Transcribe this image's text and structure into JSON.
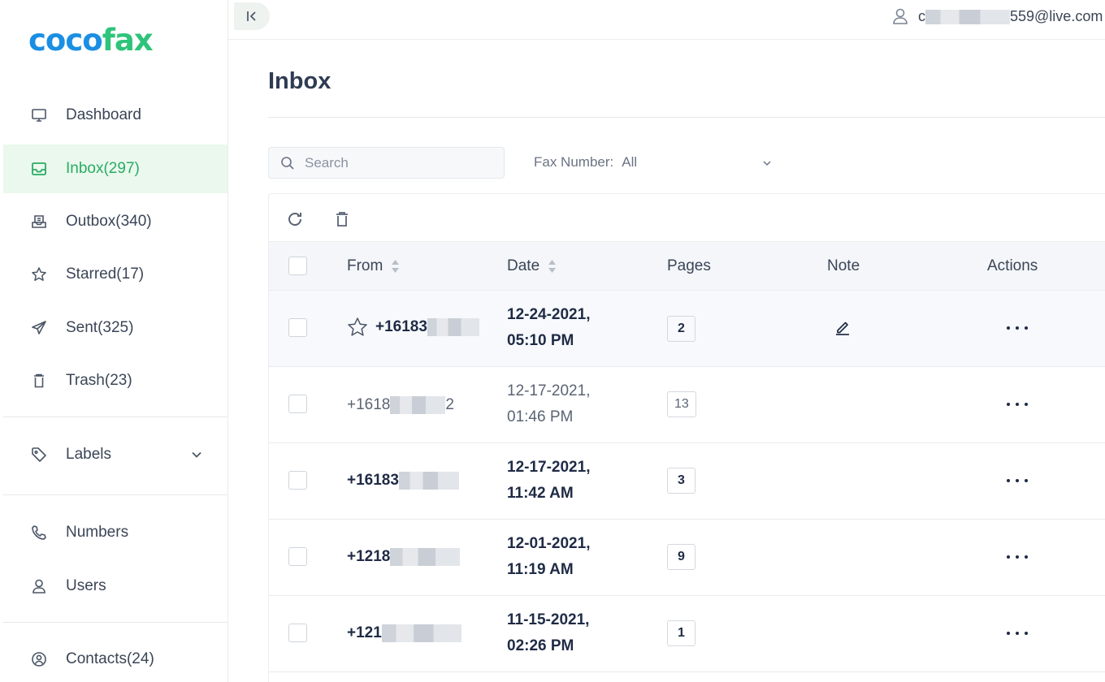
{
  "app": {
    "logo_part1": "coco",
    "logo_part2": "fax",
    "brand_blue": "#1a8fe3",
    "brand_green": "#2ec47a"
  },
  "sidebar": {
    "items": [
      {
        "label": "Dashboard",
        "icon": "monitor-icon"
      },
      {
        "label": "Inbox(297)",
        "icon": "inbox-icon",
        "active": true
      },
      {
        "label": "Outbox(340)",
        "icon": "outbox-icon"
      },
      {
        "label": "Starred(17)",
        "icon": "star-icon"
      },
      {
        "label": "Sent(325)",
        "icon": "paper-plane-icon"
      },
      {
        "label": "Trash(23)",
        "icon": "trash-icon"
      },
      {
        "label": "Labels",
        "icon": "tag-icon"
      },
      {
        "label": "Numbers",
        "icon": "phone-icon"
      },
      {
        "label": "Users",
        "icon": "user-icon"
      },
      {
        "label": "Contacts(24)",
        "icon": "contact-circle-icon"
      }
    ]
  },
  "topbar": {
    "email_prefix": "c",
    "email_suffix": "559@live.com"
  },
  "main": {
    "title": "Inbox",
    "search_placeholder": "Search",
    "fax_number_label": "Fax Number:",
    "fax_number_value": "All"
  },
  "table": {
    "columns": {
      "from": "From",
      "date": "Date",
      "pages": "Pages",
      "note": "Note",
      "actions": "Actions"
    },
    "rows": [
      {
        "from_visible": "+16183",
        "date_line1": "12-24-2021,",
        "date_line2": "05:10 PM",
        "pages": "2",
        "unread": true,
        "starred_icon": true,
        "note_icon": true
      },
      {
        "from_visible": "+1618",
        "from_tail": "2",
        "date_line1": "12-17-2021,",
        "date_line2": "01:46 PM",
        "pages": "13",
        "unread": false
      },
      {
        "from_visible": "+16183",
        "date_line1": "12-17-2021,",
        "date_line2": "11:42 AM",
        "pages": "3",
        "unread": true
      },
      {
        "from_visible": "+1218",
        "date_line1": "12-01-2021,",
        "date_line2": "11:19 AM",
        "pages": "9",
        "unread": true
      },
      {
        "from_visible": "+121",
        "date_line1": "11-15-2021,",
        "date_line2": "02:26 PM",
        "pages": "1",
        "unread": true
      }
    ]
  },
  "colors": {
    "active_bg": "#eaf8ee",
    "active_text": "#2aab63",
    "header_bg": "#f4f6f9"
  }
}
